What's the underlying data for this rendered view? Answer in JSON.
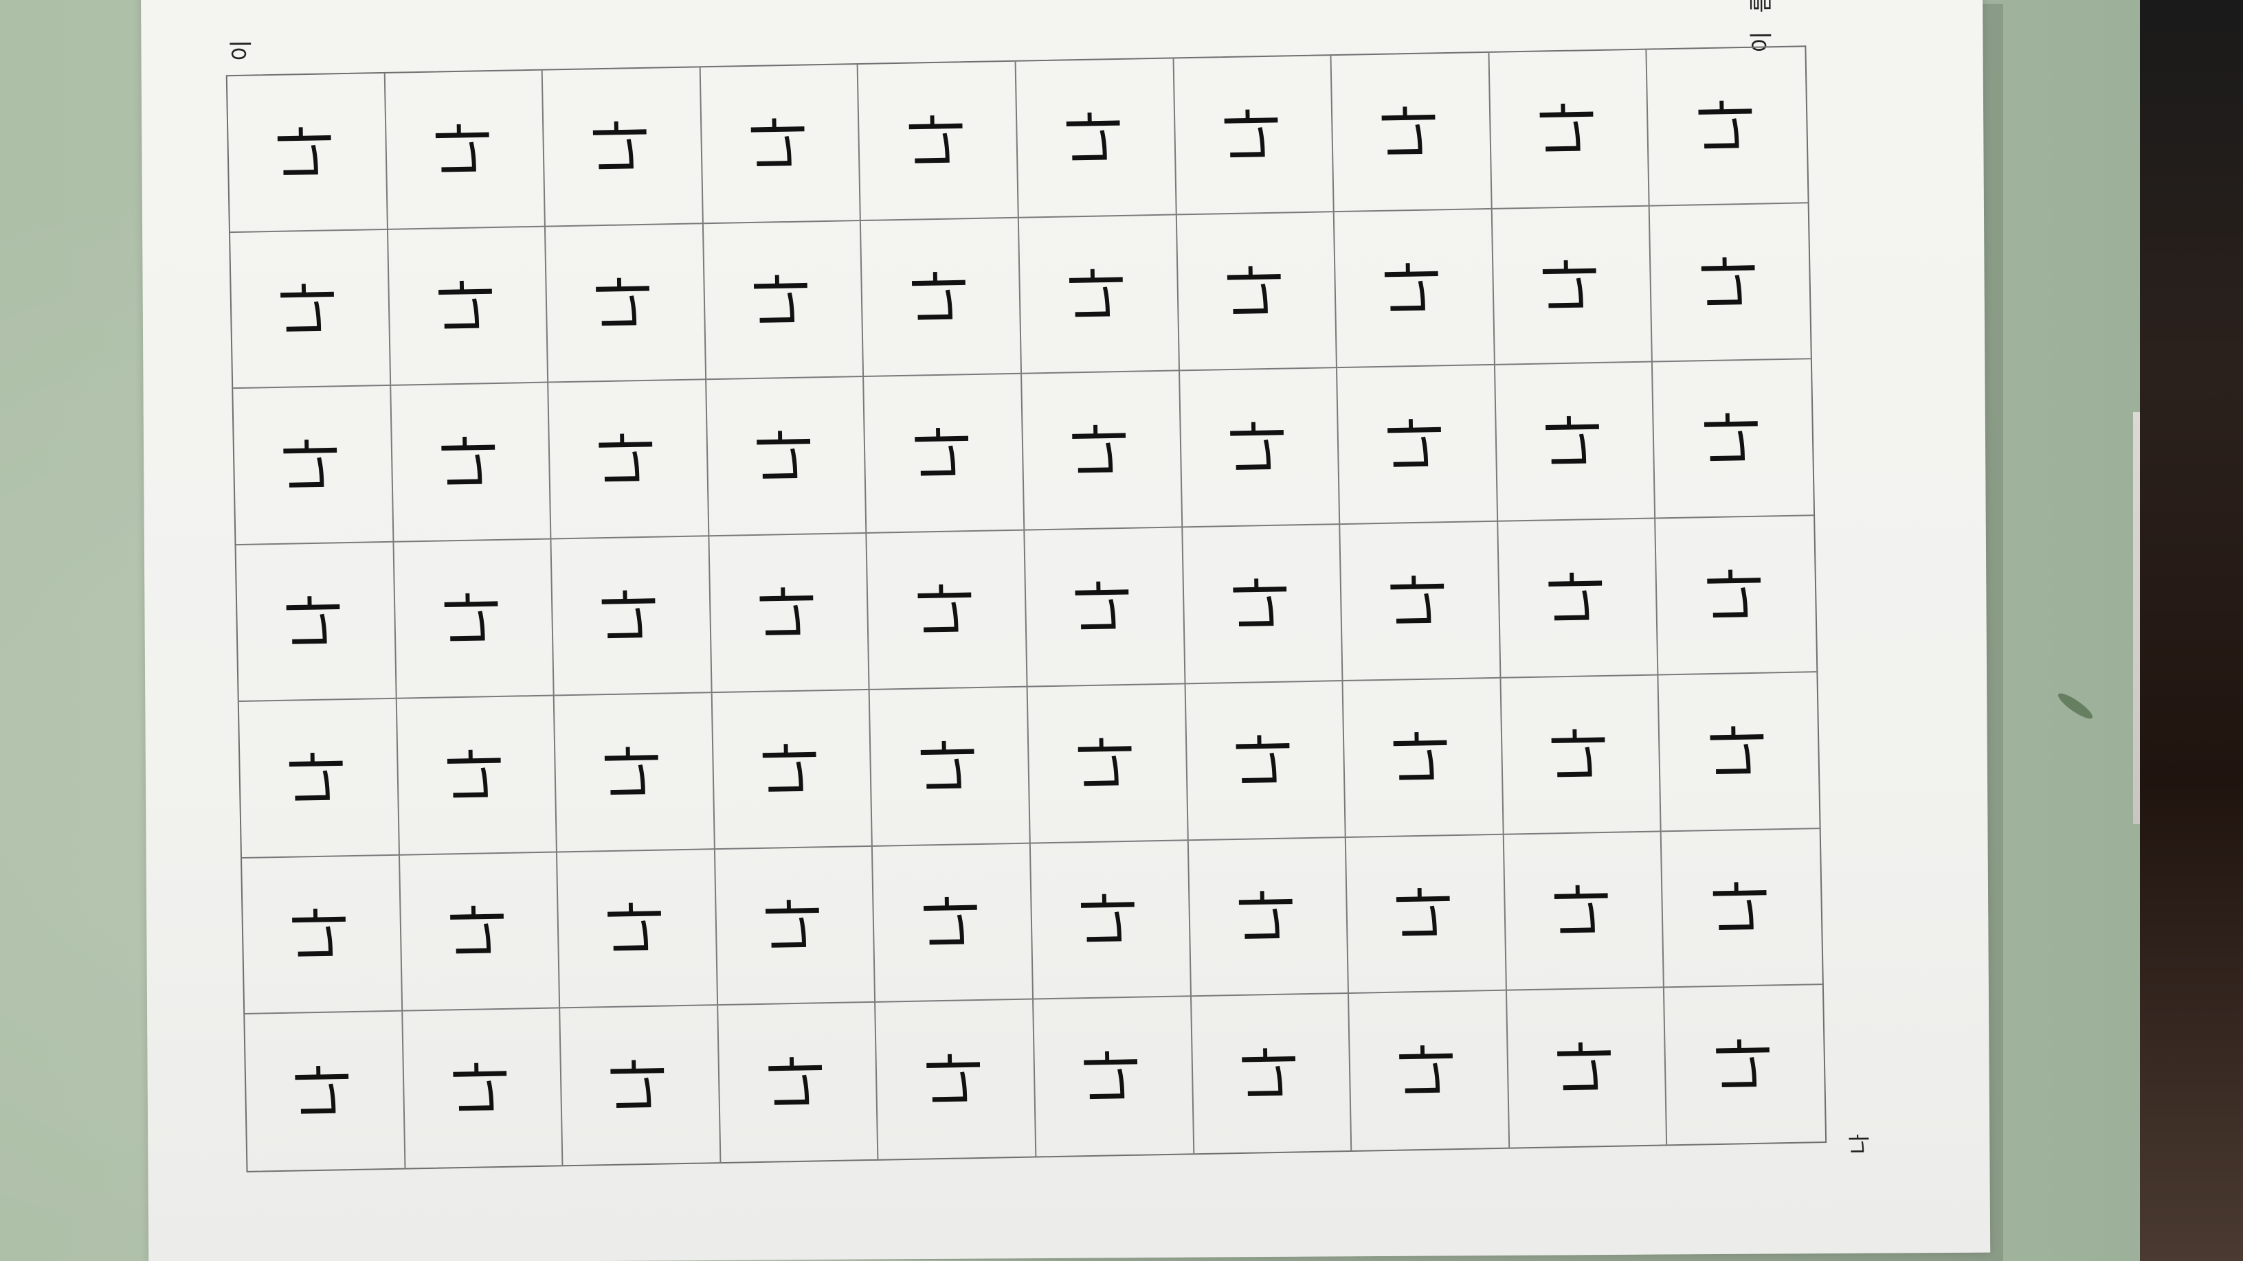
{
  "worksheet": {
    "corner_top_left": "이",
    "corner_top_right": "이 름",
    "corner_bottom_right": "나",
    "practice_glyph": "나",
    "rows": 7,
    "columns": 10
  }
}
